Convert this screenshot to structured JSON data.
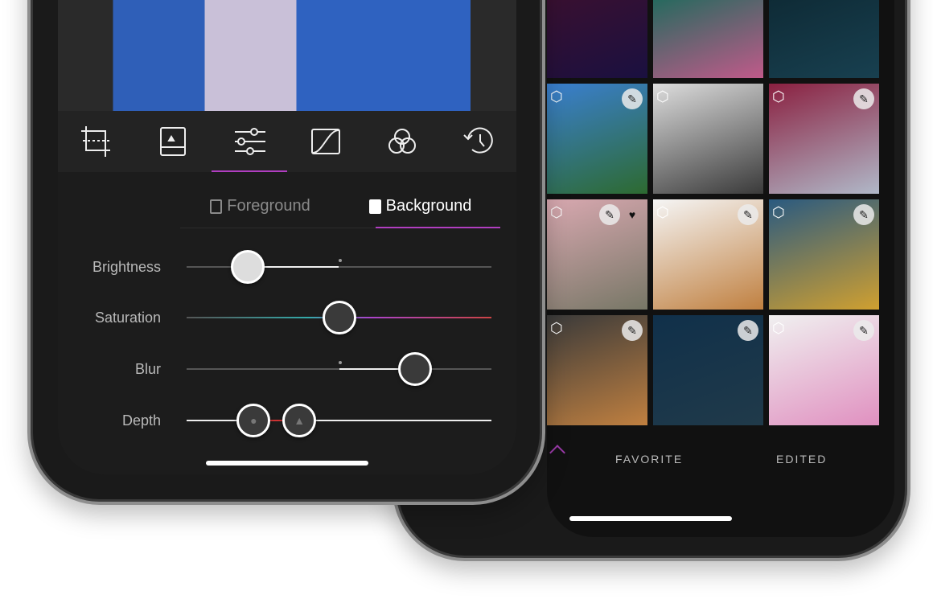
{
  "editor": {
    "tools": [
      {
        "icon": "crop-icon"
      },
      {
        "icon": "image-icon"
      },
      {
        "icon": "sliders-icon",
        "active": true
      },
      {
        "icon": "curves-icon"
      },
      {
        "icon": "color-mix-icon"
      },
      {
        "icon": "history-icon"
      }
    ],
    "tabs": [
      {
        "label": "Foreground"
      },
      {
        "label": "Background",
        "active": true
      }
    ],
    "sliders": [
      {
        "label": "Brightness",
        "value": 0.2
      },
      {
        "label": "Saturation",
        "value": 0.5
      },
      {
        "label": "Blur",
        "value": 0.75
      },
      {
        "label": "Depth",
        "values": [
          0.22,
          0.37
        ]
      }
    ],
    "accent": "#b03ec0"
  },
  "gallery": {
    "tiles": [
      {
        "colors": [
          "#3a1030",
          "#1a1040"
        ]
      },
      {
        "colors": [
          "#1f6a5c",
          "#c05a8a"
        ]
      },
      {
        "colors": [
          "#0e2a35",
          "#184050"
        ]
      },
      {
        "colors": [
          "#3a7fd0",
          "#2d6a30"
        ],
        "cube": true,
        "edit": true
      },
      {
        "colors": [
          "#ddd",
          "#3a3a3a"
        ],
        "cube": true
      },
      {
        "colors": [
          "#8a2040",
          "#b0b8c8"
        ],
        "cube": true,
        "edit": true
      },
      {
        "colors": [
          "#d8a8b0",
          "#776"
        ],
        "cube": true,
        "edit": true,
        "favorite": true
      },
      {
        "colors": [
          "#f5f5f5",
          "#c08040"
        ],
        "cube": true,
        "edit": true
      },
      {
        "colors": [
          "#2a5a80",
          "#d0a030"
        ],
        "cube": true,
        "edit": true
      },
      {
        "colors": [
          "#3a3a3a",
          "#c08040"
        ],
        "cube": true,
        "edit": true
      },
      {
        "colors": [
          "#10304a",
          "#203a4a"
        ],
        "edit": true
      },
      {
        "colors": [
          "#f0f0f0",
          "#e090c0"
        ],
        "cube": true,
        "edit": true
      }
    ],
    "bottom": {
      "up_icon": "chevron-up-icon",
      "favorite": "FAVORITE",
      "edited": "EDITED"
    }
  }
}
